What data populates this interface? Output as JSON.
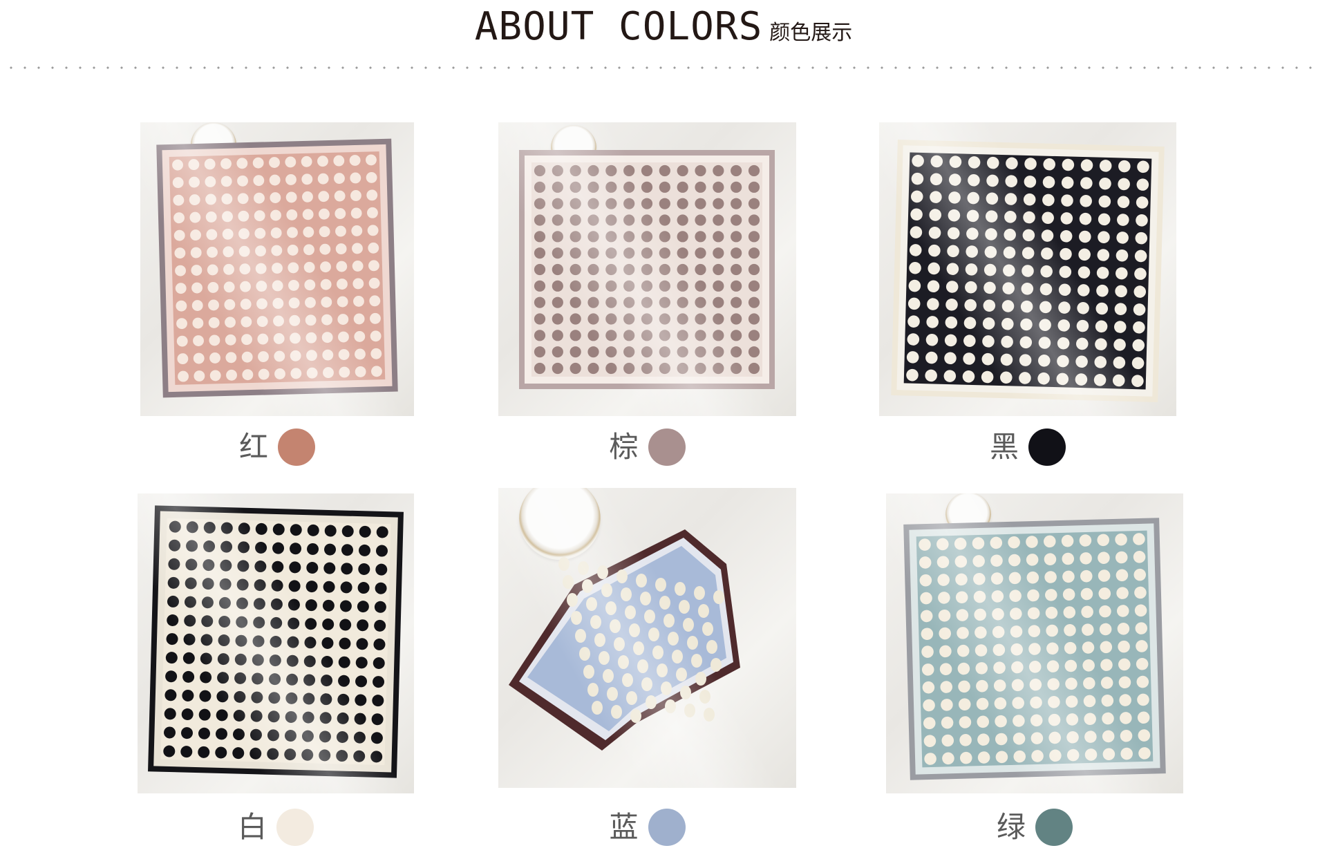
{
  "header": {
    "title": "ABOUT COLORS",
    "subtitle": "颜色展示"
  },
  "items": [
    {
      "name": "红",
      "swatch": "#c48470",
      "field": "#dba99c",
      "dot": "#f6e8df",
      "border": "#8d7f86",
      "inner": "#efd8d1"
    },
    {
      "name": "棕",
      "swatch": "#a9908f",
      "field": "#ece0da",
      "dot": "#9a817e",
      "border": "#b9a6a6",
      "inner": "#f5ede8"
    },
    {
      "name": "黑",
      "swatch": "#111117",
      "field": "#1c1c24",
      "dot": "#f3eee3",
      "border": "#efe8d8",
      "inner": "#f4f1ea"
    },
    {
      "name": "白",
      "swatch": "#f3ebe0",
      "field": "#f1eadc",
      "dot": "#121216",
      "border": "#141418",
      "inner": "#e9e3d6"
    },
    {
      "name": "蓝",
      "swatch": "#9fb0cd",
      "field": "#a8bad8",
      "dot": "#efe9d8",
      "border": "#4f2a2c",
      "inner": "#e3e6ee"
    },
    {
      "name": "绿",
      "swatch": "#628383",
      "field": "#98b6b9",
      "dot": "#f4eddf",
      "border": "#9a9ca2",
      "inner": "#dde6e6"
    }
  ]
}
